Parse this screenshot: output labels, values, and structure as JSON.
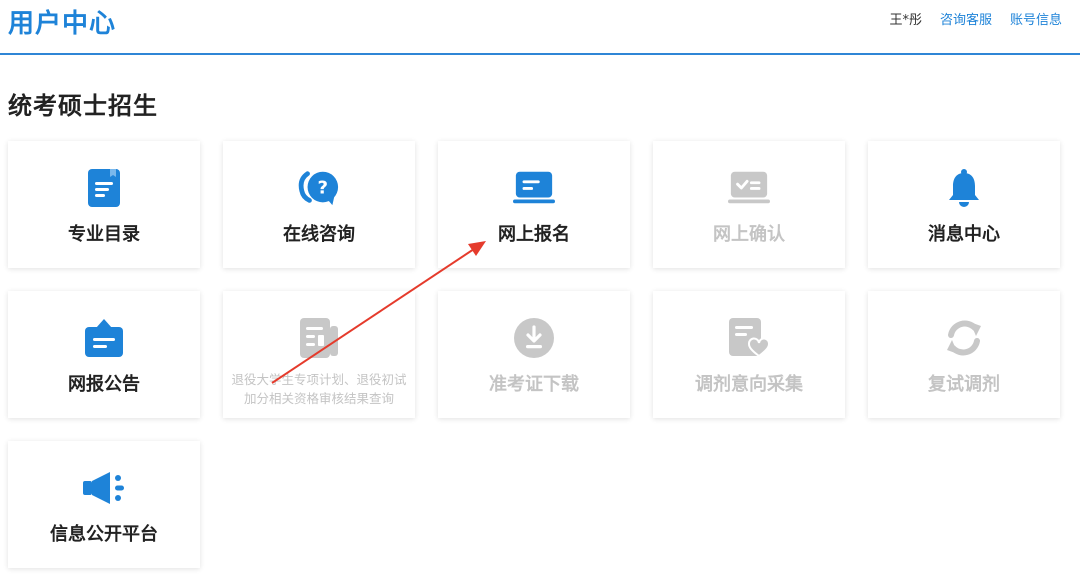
{
  "header": {
    "brand": "用户中心",
    "user_name": "王*彤",
    "links": [
      "咨询客服",
      "账号信息"
    ]
  },
  "section_title": "统考硕士招生",
  "tiles": [
    {
      "label": "专业目录",
      "icon": "document-icon",
      "enabled": true
    },
    {
      "label": "在线咨询",
      "icon": "question-chat-icon",
      "enabled": true
    },
    {
      "label": "网上报名",
      "icon": "laptop-icon",
      "enabled": true
    },
    {
      "label": "网上确认",
      "icon": "check-laptop-icon",
      "enabled": false
    },
    {
      "label": "消息中心",
      "icon": "bell-icon",
      "enabled": true
    },
    {
      "label": "网报公告",
      "icon": "notice-board-icon",
      "enabled": true
    },
    {
      "label": "退役大学生专项计划、退役初试加分相关资格审核结果查询",
      "icon": "newspaper-icon",
      "enabled": false
    },
    {
      "label": "准考证下载",
      "icon": "download-icon",
      "enabled": false
    },
    {
      "label": "调剂意向采集",
      "icon": "heart-document-icon",
      "enabled": false
    },
    {
      "label": "复试调剂",
      "icon": "refresh-icon",
      "enabled": false
    },
    {
      "label": "信息公开平台",
      "icon": "megaphone-icon",
      "enabled": true
    }
  ],
  "colors": {
    "accent": "#1e83d8",
    "disabled": "#c4c4c4",
    "annotation_arrow": "#e53b2c"
  }
}
